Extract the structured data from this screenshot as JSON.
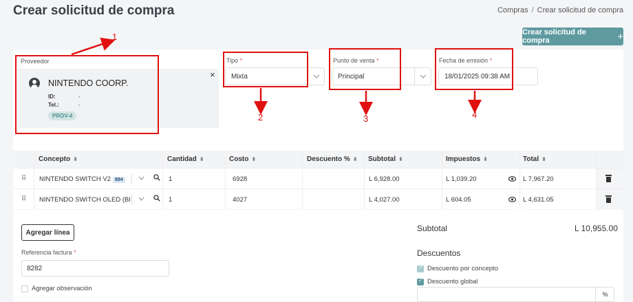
{
  "header": {
    "title": "Crear solicitud de compra",
    "breadcrumb": [
      "Compras",
      "Crear solicitud de compra"
    ],
    "breadcrumb_sep": "/",
    "create_button": "Crear solicitud de compra",
    "create_button_icon": "+"
  },
  "form": {
    "proveedor_label": "Proveedor",
    "proveedor": {
      "name": "NINTENDO COORP.",
      "id_label": "ID:",
      "id_value": "-",
      "tel_label": "Tel.:",
      "tel_value": "-",
      "badge": "PROV-4",
      "close": "×"
    },
    "tipo": {
      "label": "Tipo",
      "value": "Mixta"
    },
    "punto_venta": {
      "label": "Punto de venta",
      "value": "Principal"
    },
    "fecha": {
      "label": "Fecha de emisión",
      "value": "18/01/2025 09:38 AM"
    },
    "required_mark": "*"
  },
  "annotations": [
    "1",
    "2",
    "3",
    "4"
  ],
  "table": {
    "headers": [
      "Concepto",
      "Cantidad",
      "Costo",
      "Descuento %",
      "Subtotal",
      "Impuestos",
      "Total"
    ],
    "sort_icon": "⬍",
    "rows": [
      {
        "concepto": "NINTENDO SWITCH V2",
        "badge": "894",
        "cantidad": "1",
        "costo": "6928",
        "descuento": "",
        "subtotal": "L 6,928.00",
        "impuestos": "L 1,039.20",
        "total": "L 7,967.20"
      },
      {
        "concepto": "NINTENDO SWITCH OLED (BLAN",
        "badge": "",
        "cantidad": "1",
        "costo": "4027",
        "descuento": "",
        "subtotal": "L 4,027.00",
        "impuestos": "L 604.05",
        "total": "L 4,631.05"
      }
    ]
  },
  "bottom": {
    "add_line": "Agregar línea",
    "ref_label": "Referencia factura",
    "ref_value": "8282",
    "observacion": "Agregar observación",
    "subtotal_label": "Subtotal",
    "subtotal_value": "L 10,955.00",
    "descuentos_title": "Descuentos",
    "desc_concepto": "Descuento por concepto",
    "desc_global": "Descuento global",
    "pct": "%"
  },
  "colors": {
    "accent": "#5e9aa0",
    "annotation": "#e01010"
  }
}
